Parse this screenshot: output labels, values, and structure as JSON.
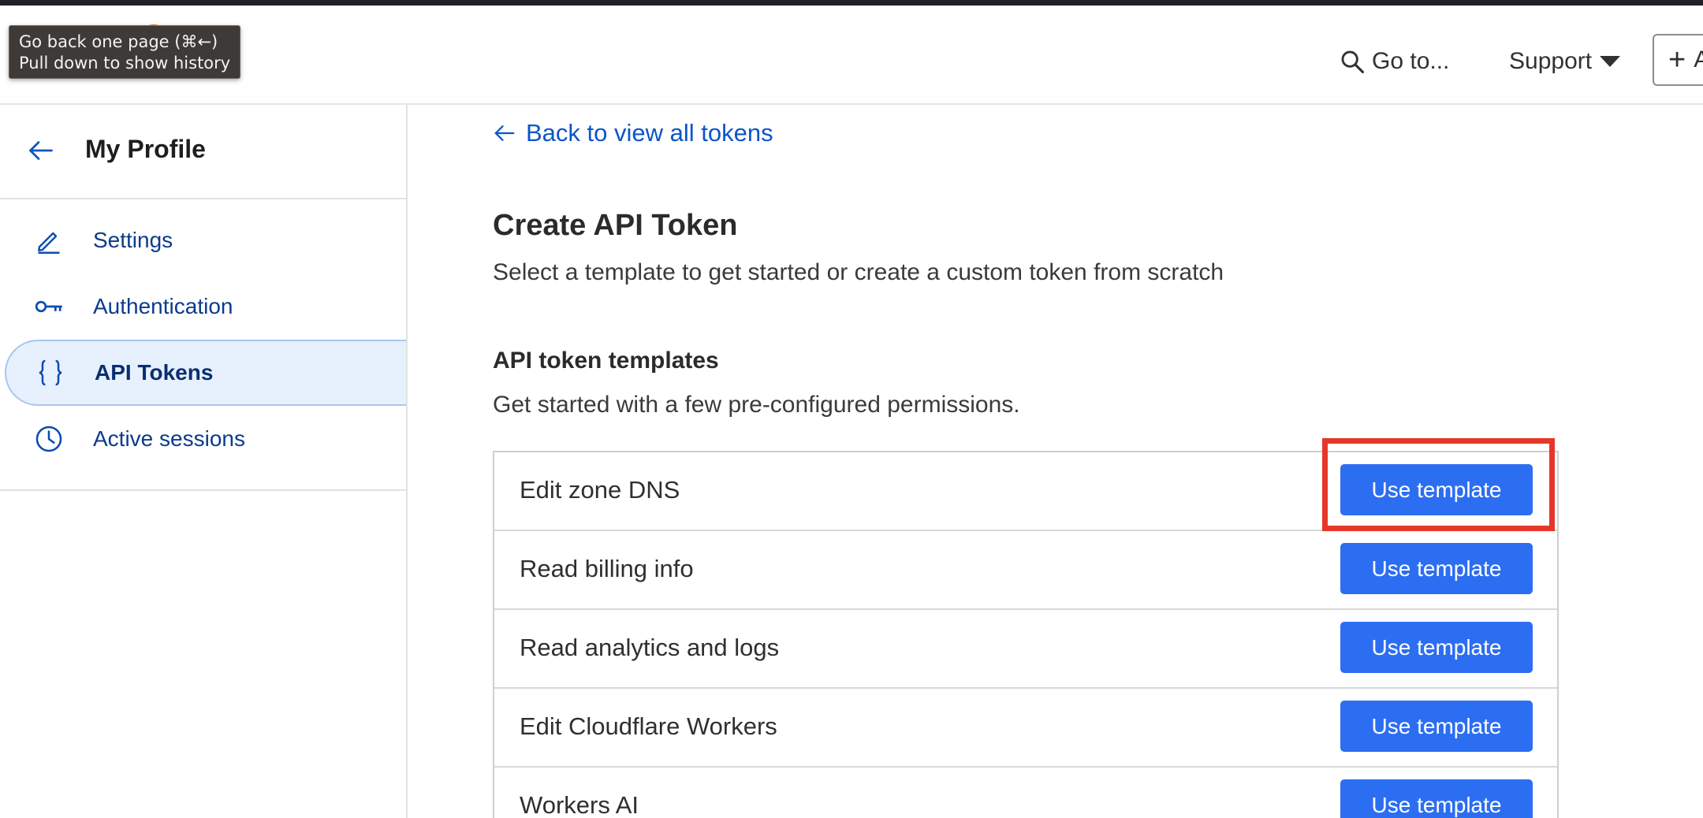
{
  "tooltip": {
    "line1": "Go back one page (⌘←)",
    "line2": "Pull down to show history"
  },
  "header": {
    "goto_label": "Go to...",
    "support_label": "Support",
    "add_label": "+",
    "add_rest": "A"
  },
  "sidebar": {
    "title": "My Profile",
    "items": [
      {
        "label": "Settings",
        "icon": "pencil-icon"
      },
      {
        "label": "Authentication",
        "icon": "key-icon"
      },
      {
        "label": "API Tokens",
        "icon": "braces-icon",
        "active": true
      },
      {
        "label": "Active sessions",
        "icon": "clock-icon"
      }
    ]
  },
  "main": {
    "back_link": "Back to view all tokens",
    "title": "Create API Token",
    "subtitle": "Select a template to get started or create a custom token from scratch",
    "templates_title": "API token templates",
    "templates_subtitle": "Get started with a few pre-configured permissions.",
    "templates": [
      {
        "name": "Edit zone DNS",
        "button": "Use template"
      },
      {
        "name": "Read billing info",
        "button": "Use template"
      },
      {
        "name": "Read analytics and logs",
        "button": "Use template"
      },
      {
        "name": "Edit Cloudflare Workers",
        "button": "Use template"
      },
      {
        "name": "Workers AI",
        "button": "Use template"
      }
    ]
  },
  "colors": {
    "accent": "#2c6ef2",
    "link": "#0b55c9",
    "highlight": "#e5372a"
  }
}
